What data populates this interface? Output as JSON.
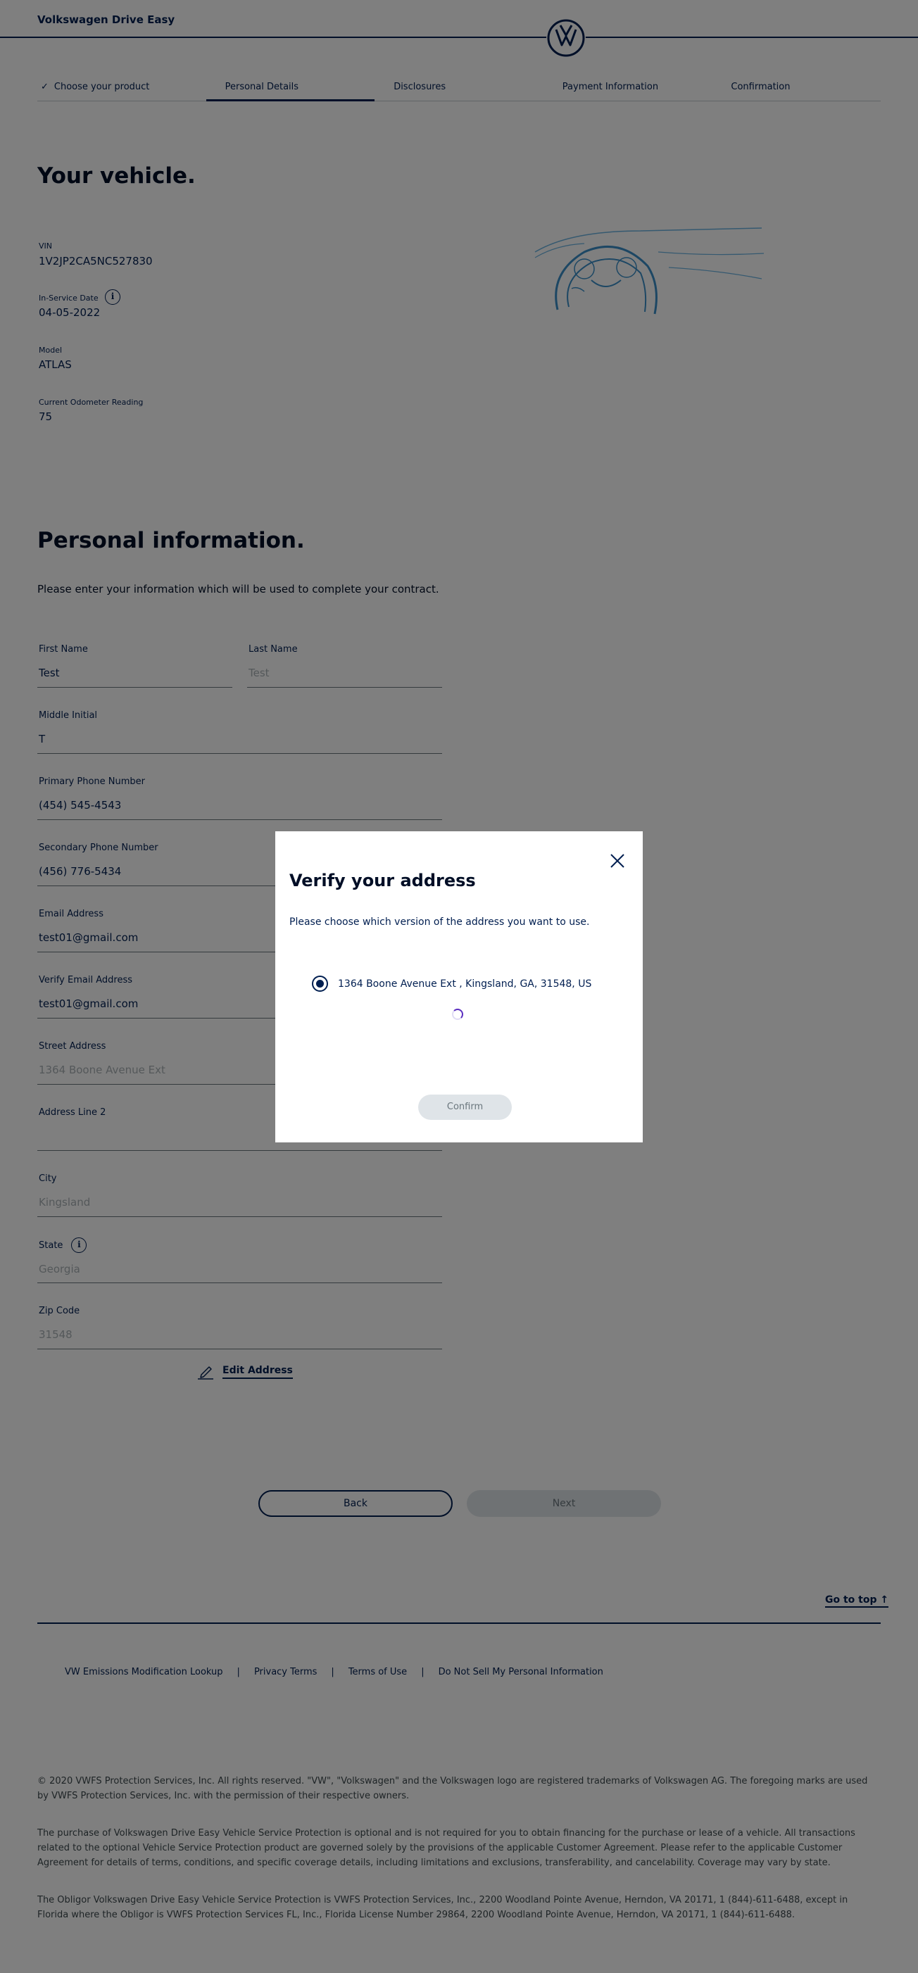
{
  "header": {
    "brand": "Volkswagen Drive Easy"
  },
  "stepper": {
    "check_icon": "✓",
    "steps": [
      {
        "label": "Choose your product",
        "state": "done"
      },
      {
        "label": "Personal Details",
        "state": "active"
      },
      {
        "label": "Disclosures",
        "state": "pending"
      },
      {
        "label": "Payment Information",
        "state": "pending"
      },
      {
        "label": "Confirmation",
        "state": "pending"
      }
    ]
  },
  "vehicle": {
    "title": "Your vehicle.",
    "vin_label": "VIN",
    "vin": "1V2JP2CA5NC527830",
    "in_service_label": "In-Service Date",
    "in_service_date": "04-05-2022",
    "info_glyph": "i",
    "model_label": "Model",
    "model": "ATLAS",
    "odometer_label": "Current Odometer Reading",
    "odometer": "75"
  },
  "personal": {
    "title": "Personal information.",
    "intro": "Please enter your information which will be used to complete your contract.",
    "first_name_label": "First Name",
    "first_name": "Test",
    "last_name_label": "Last Name",
    "last_name": "Test",
    "middle_initial_label": "Middle Initial",
    "middle_initial": "T",
    "primary_phone_label": "Primary Phone Number",
    "primary_phone": "(454) 545-4543",
    "secondary_phone_label": "Secondary Phone Number",
    "secondary_phone": "(456) 776-5434",
    "email_label": "Email Address",
    "email": "test01@gmail.com",
    "verify_email_label": "Verify Email Address",
    "verify_email": "test01@gmail.com",
    "street_label": "Street Address",
    "street": "1364 Boone Avenue Ext",
    "address2_label": "Address Line 2",
    "address2": "",
    "city_label": "City",
    "city": "Kingsland",
    "state_label": "State",
    "state": "Georgia",
    "zip_label": "Zip Code",
    "zip": "31548",
    "edit_address": "Edit Address"
  },
  "nav": {
    "back": "Back",
    "next": "Next"
  },
  "footer": {
    "go_top": "Go to top",
    "go_top_arrow": "↑",
    "links": [
      "VW Emissions Modification Lookup",
      "Privacy Terms",
      "Terms of Use",
      "Do Not Sell My Personal Information"
    ],
    "separator": "|",
    "legal_1": "© 2020 VWFS Protection Services, Inc. All rights reserved. \"VW\", \"Volkswagen\" and the Volkswagen logo are registered trademarks of Volkswagen AG. The foregoing marks are used by VWFS Protection Services, Inc. with the permission of their respective owners.",
    "legal_2": "The purchase of Volkswagen Drive Easy Vehicle Service Protection is optional and is not required for you to obtain financing for the purchase or lease of a vehicle. All transactions related to the optional Vehicle Service Protection product are governed solely by the provisions of the applicable Customer Agreement. Please refer to the applicable Customer Agreement for details of terms, conditions, and specific coverage details, including limitations and exclusions, transferability, and cancelability. Coverage may vary by state.",
    "legal_3": "The Obligor Volkswagen Drive Easy Vehicle Service Protection is VWFS Protection Services, Inc., 2200 Woodland Pointe Avenue, Herndon, VA 20171, 1 (844)-611-6488, except in Florida where the Obligor is VWFS Protection Services FL, Inc., Florida License Number 29864, 2200 Woodland Pointe Avenue, Herndon, VA 20171, 1 (844)-611-6488."
  },
  "modal": {
    "title": "Verify your address",
    "description": "Please choose which version of the address you want to use.",
    "option": "1364 Boone Avenue Ext , Kingsland, GA, 31548, US",
    "confirm": "Confirm"
  },
  "colors": {
    "primary": "#001e50",
    "disabled_bg": "#dfe4e8",
    "spinner": "#5b2fc0",
    "overlay": "rgba(0,0,0,0.5)"
  }
}
